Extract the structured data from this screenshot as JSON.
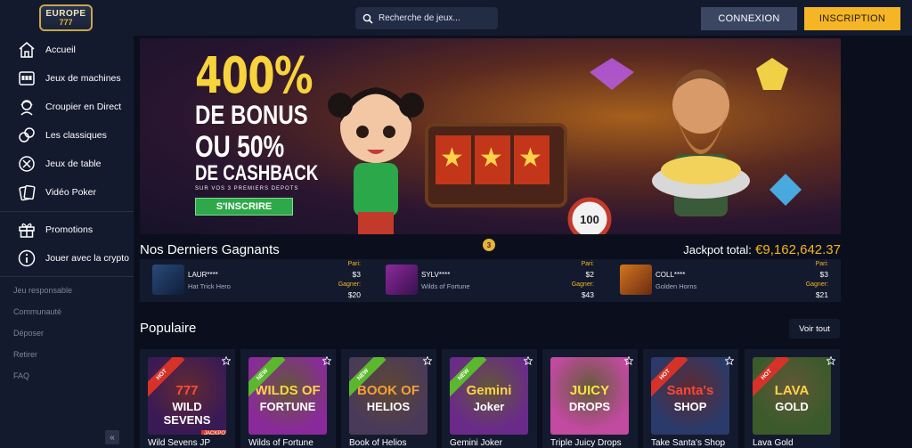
{
  "header": {
    "logo_line1": "EUROPE",
    "logo_line2": "777",
    "search_placeholder": "Recherche de jeux...",
    "login_label": "CONNEXION",
    "signup_label": "INSCRIPTION"
  },
  "sidebar": {
    "items": [
      {
        "label": "Accueil",
        "icon": "home-icon"
      },
      {
        "label": "Jeux de machines",
        "icon": "slot-machine-icon"
      },
      {
        "label": "Croupier en Direct",
        "icon": "dealer-icon"
      },
      {
        "label": "Les classiques",
        "icon": "cards-icon"
      },
      {
        "label": "Jeux de table",
        "icon": "chip-icon"
      },
      {
        "label": "Vidéo Poker",
        "icon": "video-poker-icon"
      },
      {
        "label": "Promotions",
        "icon": "gift-icon"
      },
      {
        "label": "Jouer avec la crypto",
        "icon": "info-icon"
      }
    ],
    "links": [
      "Jeu responsable",
      "Communauté",
      "Déposer",
      "Retirer",
      "FAQ"
    ],
    "collapse_label": "«"
  },
  "banner": {
    "line1": "400%",
    "line2": "DE BONUS",
    "line3": "OU 50%",
    "line4": "DE CASHBACK",
    "line5": "SUR VOS 3 PREMIERS DEPOTS",
    "cta": "S'INSCRIRE"
  },
  "winners": {
    "title": "Nos Derniers Gagnants",
    "jackpot_label": "Jackpot total:",
    "jackpot_value": "€9,162,642.37",
    "medal": "3",
    "bet_label": "Pari:",
    "win_label": "Gagner:",
    "entries": [
      {
        "name": "LAUR****",
        "game": "Hat Trick Hero",
        "bet": "$3",
        "win": "$20",
        "color": "#2a4a7a"
      },
      {
        "name": "SYLV****",
        "game": "Wilds of Fortune",
        "bet": "$2",
        "win": "$43",
        "color": "#7a2a8a"
      },
      {
        "name": "COLL****",
        "game": "Golden Horns",
        "bet": "$3",
        "win": "$21",
        "color": "#b4561e"
      }
    ]
  },
  "popular": {
    "title": "Populaire",
    "see_all": "Voir tout",
    "games": [
      {
        "name": "Wild Sevens JP",
        "ribbon": "HOT",
        "ribbon_color": "#d6322a",
        "bg": "#3a1a55",
        "art1": "777",
        "art2": "WILD SEVENS",
        "jackpot": "JACKPOT",
        "text_color": "#ff4a3a"
      },
      {
        "name": "Wilds of Fortune",
        "ribbon": "NEW",
        "ribbon_color": "#5bb82e",
        "bg": "#8a2a9a",
        "art1": "WILDS OF",
        "art2": "FORTUNE",
        "jackpot": "",
        "text_color": "#ffd24a"
      },
      {
        "name": "Book of Helios",
        "ribbon": "NEW",
        "ribbon_color": "#5bb82e",
        "bg": "#4a3a5a",
        "art1": "BOOK OF",
        "art2": "HELIOS",
        "jackpot": "",
        "text_color": "#f2a03a"
      },
      {
        "name": "Gemini Joker",
        "ribbon": "NEW",
        "ribbon_color": "#5bb82e",
        "bg": "#6a2a8a",
        "art1": "Gemini",
        "art2": "Joker",
        "jackpot": "",
        "text_color": "#ffd24a"
      },
      {
        "name": "Triple Juicy Drops",
        "ribbon": "",
        "ribbon_color": "",
        "bg": "#c24aa0",
        "art1": "JUICY",
        "art2": "DROPS",
        "jackpot": "",
        "text_color": "#ffe04a"
      },
      {
        "name": "Take Santa's Shop",
        "ribbon": "HOT",
        "ribbon_color": "#d6322a",
        "bg": "#2a3a6a",
        "art1": "Santa's",
        "art2": "SHOP",
        "jackpot": "",
        "text_color": "#f24a3a"
      },
      {
        "name": "Lava Gold",
        "ribbon": "HOT",
        "ribbon_color": "#d6322a",
        "bg": "#3a5a2a",
        "art1": "LAVA",
        "art2": "GOLD",
        "jackpot": "",
        "text_color": "#ffd24a"
      }
    ]
  }
}
